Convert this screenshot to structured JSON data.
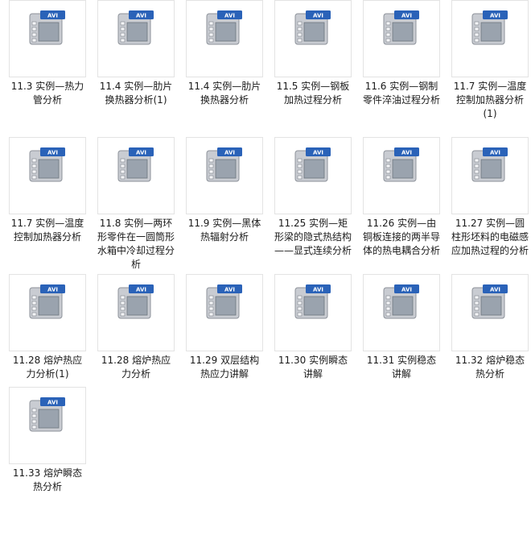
{
  "icon": {
    "badge_text": "AVI",
    "name": "avi-video-file-icon",
    "badge_color": "#2a62b8",
    "body_color": "#c9ccd2",
    "screen_color": "#9aa3ae"
  },
  "files": [
    {
      "name": "11.3 实例—热力管分析"
    },
    {
      "name": "11.4 实例—肋片换热器分析(1)"
    },
    {
      "name": "11.4 实例—肋片换热器分析"
    },
    {
      "name": "11.5 实例—钢板加热过程分析"
    },
    {
      "name": "11.6 实例—钢制零件淬油过程分析"
    },
    {
      "name": "11.7 实例—温度控制加热器分析(1)"
    },
    {
      "name": "11.7 实例—温度控制加热器分析"
    },
    {
      "name": "11.8 实例—两环形零件在一圆筒形水箱中冷却过程分析"
    },
    {
      "name": "11.9 实例—黑体热辐射分析"
    },
    {
      "name": "11.25 实例—矩形梁的隐式热结构——显式连续分析"
    },
    {
      "name": "11.26 实例—由铜板连接的两半导体的热电耦合分析"
    },
    {
      "name": "11.27 实例—圆柱形坯料的电磁感应加热过程的分析"
    },
    {
      "name": "11.28 熔炉热应力分析(1)"
    },
    {
      "name": "11.28 熔炉热应力分析"
    },
    {
      "name": "11.29 双层结构热应力讲解"
    },
    {
      "name": "11.30 实例瞬态讲解"
    },
    {
      "name": "11.31 实例稳态讲解"
    },
    {
      "name": "11.32 熔炉稳态热分析"
    },
    {
      "name": "11.33 熔炉瞬态热分析"
    }
  ]
}
